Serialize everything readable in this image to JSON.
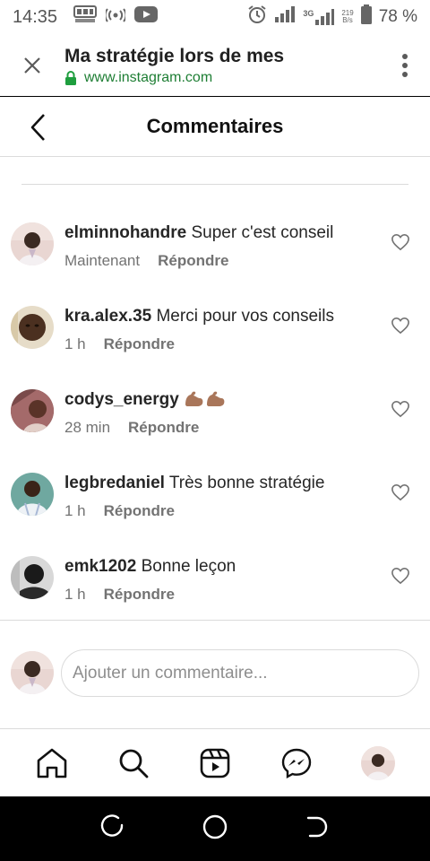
{
  "status_bar": {
    "time": "14:35",
    "network": "3G",
    "speed_value": "219",
    "speed_unit": "B/s",
    "battery": "78 %",
    "icons": [
      "blast-app-icon",
      "hotspot-icon",
      "youtube-icon",
      "alarm-icon",
      "signal-icon",
      "signal-3g-icon",
      "battery-icon"
    ]
  },
  "browser": {
    "page_title": "Ma stratégie lors de mes",
    "url": "www.instagram.com",
    "icons": [
      "close-icon",
      "lock-icon",
      "more-vertical-icon"
    ]
  },
  "header": {
    "title": "Commentaires",
    "back_icon": "chevron-left-icon"
  },
  "comments": [
    {
      "username": "elminnohandre",
      "text": "Super c'est conseil",
      "time": "Maintenant",
      "reply": "Répondre"
    },
    {
      "username": "kra.alex.35",
      "text": "Merci pour vos conseils",
      "time": "1 h",
      "reply": "Répondre"
    },
    {
      "username": "codys_energy",
      "text": "",
      "emoji": "flexed-biceps-x2",
      "time": "28 min",
      "reply": "Répondre"
    },
    {
      "username": "legbredaniel",
      "text": "Très bonne stratégie",
      "time": "1 h",
      "reply": "Répondre"
    },
    {
      "username": "emk1202",
      "text": "Bonne leçon",
      "time": "1 h",
      "reply": "Répondre"
    }
  ],
  "add_comment": {
    "placeholder": "Ajouter un commentaire..."
  },
  "bottom_nav": [
    "home-icon",
    "search-icon",
    "reels-icon",
    "messenger-icon",
    "profile-avatar"
  ],
  "system_nav": [
    "recents-icon",
    "home-circle-icon",
    "back-icon"
  ],
  "colors": {
    "secure_green": "#1e7e34",
    "muted_text": "#737373",
    "divider": "#dbdbdb"
  }
}
